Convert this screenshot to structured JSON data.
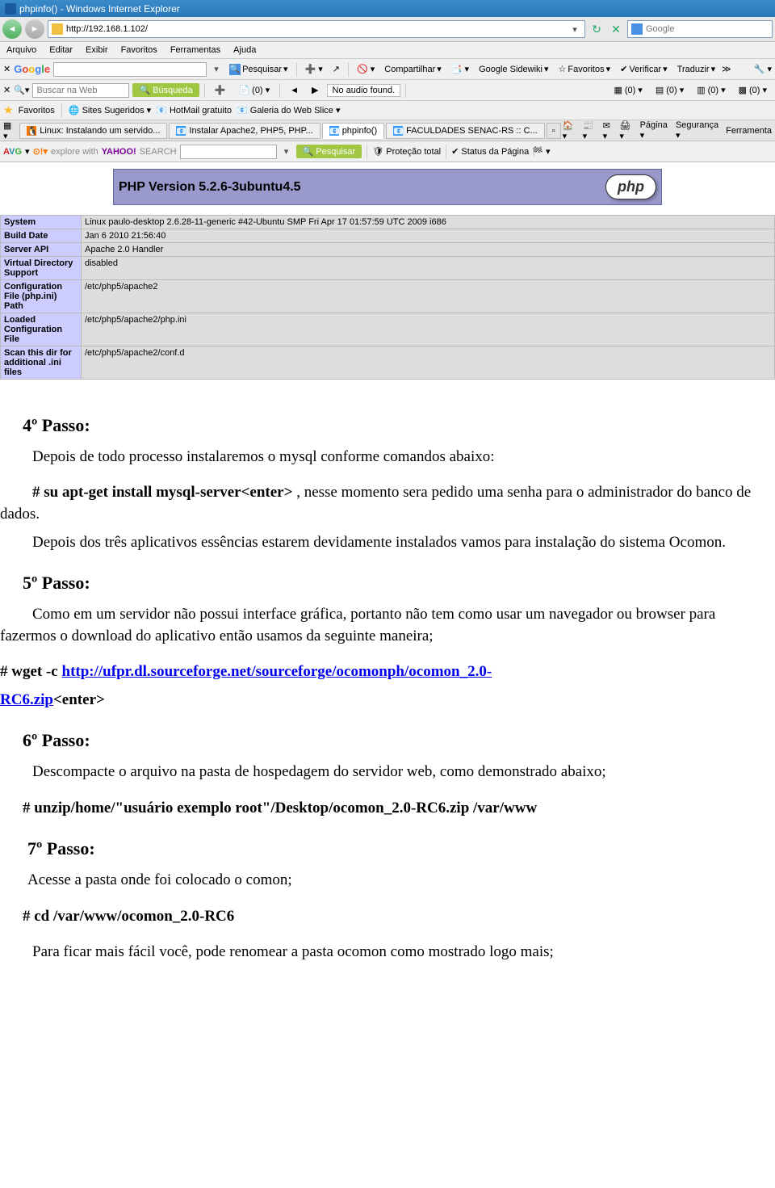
{
  "window": {
    "title": "phpinfo() - Windows Internet Explorer"
  },
  "address": {
    "url": "http://192.168.1.102/",
    "search_placeholder": "Google"
  },
  "menu": {
    "arquivo": "Arquivo",
    "editar": "Editar",
    "exibir": "Exibir",
    "favoritos": "Favoritos",
    "ferramentas": "Ferramentas",
    "ajuda": "Ajuda"
  },
  "google_tb": {
    "brand": "Google",
    "pesquisar": "Pesquisar",
    "compartilhar": "Compartilhar",
    "sidewiki": "Google Sidewiki",
    "favoritos": "Favoritos",
    "verificar": "Verificar",
    "traduzir": "Traduzir"
  },
  "web_search": {
    "placeholder": "Buscar na Web",
    "busqueda": "Búsqueda",
    "count0": "(0)",
    "noaudio": "No audio found."
  },
  "fav": {
    "label": "Favoritos",
    "sites": "Sites Sugeridos",
    "hotmail": "HotMail gratuito",
    "galeria": "Galeria do Web Slice"
  },
  "tabs": {
    "t1": "Linux: Instalando um servido...",
    "t2": "Instalar Apache2, PHP5, PHP...",
    "t3": "phpinfo()",
    "t4": "FACULDADES SENAC-RS :: C...",
    "pagina": "Página",
    "seguranca": "Segurança",
    "ferramenta": "Ferramenta"
  },
  "avg": {
    "brand": "AVG",
    "explore": "explore with",
    "yahoo": "YAHOO!",
    "search": "SEARCH",
    "pesquisar": "Pesquisar",
    "protecao": "Proteção total",
    "status": "Status da Página"
  },
  "php": {
    "title": "PHP Version 5.2.6-3ubuntu4.5",
    "logo": "php",
    "rows": [
      {
        "k": "System",
        "v": "Linux paulo-desktop 2.6.28-11-generic #42-Ubuntu SMP Fri Apr 17 01:57:59 UTC 2009 i686"
      },
      {
        "k": "Build Date",
        "v": "Jan 6 2010 21:56:40"
      },
      {
        "k": "Server API",
        "v": "Apache 2.0 Handler"
      },
      {
        "k": "Virtual Directory Support",
        "v": "disabled"
      },
      {
        "k": "Configuration File (php.ini) Path",
        "v": "/etc/php5/apache2"
      },
      {
        "k": "Loaded Configuration File",
        "v": "/etc/php5/apache2/php.ini"
      },
      {
        "k": "Scan this dir for additional .ini files",
        "v": "/etc/php5/apache2/conf.d"
      }
    ]
  },
  "doc": {
    "p4_title": "4º Passo:",
    "p4_1": "Depois de todo processo instalaremos o mysql conforme comandos abaixo:",
    "p4_cmd": "# su apt-get install mysql-server<enter>",
    "p4_2a": " , nesse momento sera pedido uma senha para o administrador do banco de dados.",
    "p4_3": "Depois dos três aplicativos essências estarem devidamente instalados vamos para instalação do sistema Ocomon.",
    "p5_title": "5º Passo:",
    "p5_1": "Como em um servidor não possui interface gráfica, portanto não tem como usar um navegador ou browser para fazermos o download do aplicativo então usamos da seguinte maneira;",
    "p5_cmd_pref": "# wget -c ",
    "p5_link1": "http://ufpr.dl.sourceforge.net/sourceforge/ocomonph/ocomon_2.0-",
    "p5_link2": "RC6.zip",
    "p5_cmd_suf": "<enter>",
    "p6_title": "6º Passo:",
    "p6_1": "Descompacte o arquivo na pasta de hospedagem do servidor web, como demonstrado abaixo;",
    "p6_cmd": "# unzip/home/\"usuário exemplo root\"/Desktop/ocomon_2.0-RC6.zip /var/www",
    "p7_title": "7º Passo:",
    "p7_1": "Acesse a pasta onde foi colocado o comon;",
    "p7_cmd": "# cd /var/www/ocomon_2.0-RC6",
    "p7_2": "Para ficar mais fácil você, pode renomear  a pasta ocomon como mostrado logo mais;"
  }
}
